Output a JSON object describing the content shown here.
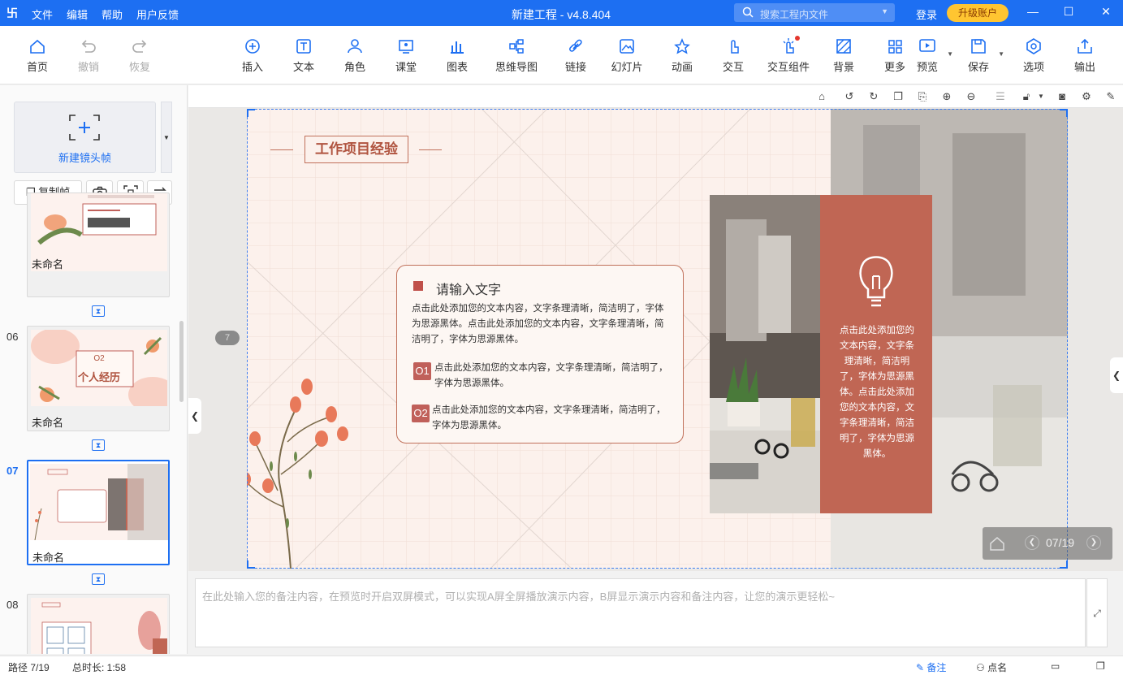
{
  "app": {
    "logo": "卐",
    "menus": [
      "文件",
      "编辑",
      "帮助",
      "用户反馈"
    ],
    "title": "新建工程 - v4.8.404",
    "search_placeholder": "搜索工程内文件",
    "login": "登录",
    "upgrade": "升级账户",
    "window_buttons": [
      "minimize-icon",
      "maximize-icon",
      "close-icon"
    ]
  },
  "toolbar": {
    "items": [
      {
        "label": "首页",
        "icon": "home-icon"
      },
      {
        "label": "撤销",
        "icon": "undo-icon"
      },
      {
        "label": "恢复",
        "icon": "redo-icon"
      },
      {
        "label": "插入",
        "icon": "plus-circle-icon"
      },
      {
        "label": "文本",
        "icon": "text-icon"
      },
      {
        "label": "角色",
        "icon": "character-icon"
      },
      {
        "label": "课堂",
        "icon": "classroom-icon"
      },
      {
        "label": "图表",
        "icon": "chart-icon"
      },
      {
        "label": "思维导图",
        "icon": "mindmap-icon"
      },
      {
        "label": "链接",
        "icon": "link-icon"
      },
      {
        "label": "幻灯片",
        "icon": "slide-icon"
      },
      {
        "label": "动画",
        "icon": "animation-icon"
      },
      {
        "label": "交互",
        "icon": "interaction-icon"
      },
      {
        "label": "交互组件",
        "icon": "interaction-component-icon"
      },
      {
        "label": "背景",
        "icon": "background-icon"
      },
      {
        "label": "更多",
        "icon": "more-icon"
      },
      {
        "label": "预览",
        "icon": "preview-icon"
      },
      {
        "label": "保存",
        "icon": "save-icon"
      },
      {
        "label": "选项",
        "icon": "options-icon"
      },
      {
        "label": "输出",
        "icon": "export-icon"
      }
    ]
  },
  "left_panel": {
    "new_frame": "新建镜头帧",
    "copy_frame": "复制帧",
    "thumbs": [
      {
        "num": "",
        "name": "未命名"
      },
      {
        "num": "06",
        "name": "未命名",
        "title": "个人经历",
        "sub": "O2"
      },
      {
        "num": "07",
        "name": "未命名",
        "selected": true
      },
      {
        "num": "08",
        "name": ""
      }
    ]
  },
  "slide": {
    "page_badge": "7",
    "title": "工作项目经验",
    "heading": "请输入文字",
    "paragraph": "点击此处添加您的文本内容，文字条理清晰，简洁明了，字体为思源黑体。点击此处添加您的文本内容，文字条理清晰，简洁明了，字体为思源黑体。",
    "items": [
      {
        "num": "O1",
        "text": "点击此处添加您的文本内容，文字条理清晰，简洁明了，字体为思源黑体。"
      },
      {
        "num": "O2",
        "text": "点击此处添加您的文本内容，文字条理清晰，简洁明了，字体为思源黑体。"
      }
    ],
    "red_panel_text": "点击此处添加您的文本内容，文字条理清晰，简洁明了，字体为思源黑体。点击此处添加您的文本内容，文字条理清晰，简洁明了，字体为思源黑体。",
    "page_indicator": "07/19"
  },
  "notes": {
    "placeholder": "在此处输入您的备注内容，在预览时开启双屏模式，可以实现A屏全屏播放演示内容，B屏显示演示内容和备注内容，让您的演示更轻松~"
  },
  "status": {
    "path": "路径 7/19",
    "duration": "总时长: 1:58",
    "notes_btn": "备注",
    "rollcall_btn": "点名"
  },
  "colors": {
    "accent": "#1d6ff2",
    "slide_accent": "#c0605a",
    "upgrade": "#ffc531"
  }
}
